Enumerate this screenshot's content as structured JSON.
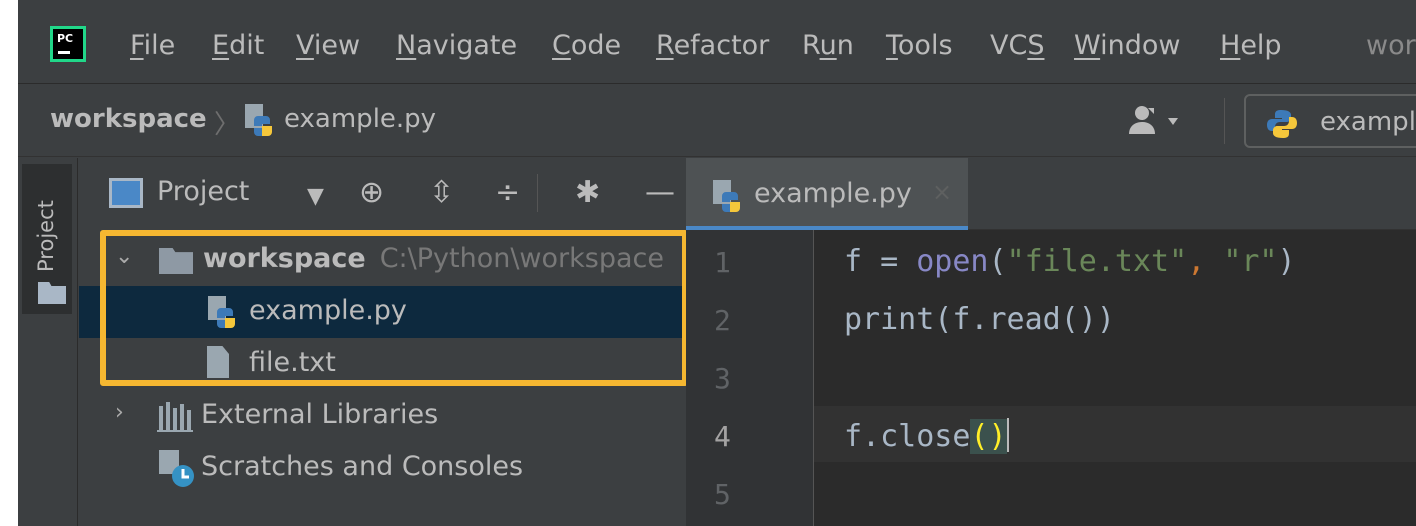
{
  "app": {
    "logo_text": "PC",
    "title_fragment": "wor"
  },
  "menu": {
    "items": [
      {
        "pre": "",
        "u": "F",
        "post": "ile"
      },
      {
        "pre": "",
        "u": "E",
        "post": "dit"
      },
      {
        "pre": "",
        "u": "V",
        "post": "iew"
      },
      {
        "pre": "",
        "u": "N",
        "post": "avigate"
      },
      {
        "pre": "",
        "u": "C",
        "post": "ode"
      },
      {
        "pre": "",
        "u": "R",
        "post": "efactor"
      },
      {
        "pre": "R",
        "u": "u",
        "post": "n"
      },
      {
        "pre": "",
        "u": "T",
        "post": "ools"
      },
      {
        "pre": "VC",
        "u": "S",
        "post": ""
      },
      {
        "pre": "",
        "u": "W",
        "post": "indow"
      },
      {
        "pre": "",
        "u": "H",
        "post": "elp"
      }
    ]
  },
  "navbar": {
    "breadcrumb_root": "workspace",
    "breadcrumb_sep": "〉",
    "breadcrumb_file": "example.py",
    "run_config_label": "exampl"
  },
  "toolstrip": {
    "project_label": "Project"
  },
  "project_panel": {
    "view_label": "Project",
    "tree": {
      "root_name": "workspace",
      "root_path": "C:\\Python\\workspace",
      "file1": "example.py",
      "file2": "file.txt",
      "external_libraries": "External Libraries",
      "scratches": "Scratches and Consoles"
    }
  },
  "editor": {
    "tab_label": "example.py",
    "tab_close": "×",
    "line_numbers": [
      "1",
      "2",
      "3",
      "4",
      "5"
    ],
    "code": {
      "line1": {
        "a": "f = ",
        "fn": "open",
        "b": "(",
        "s1": "\"file.txt\"",
        "comma": ",",
        "sp": " ",
        "s2": "\"r\"",
        "c": ")"
      },
      "line2": {
        "text": "print(f.read())"
      },
      "line4": {
        "a": "f.close",
        "b": "()"
      }
    }
  },
  "colors": {
    "highlight_box": "#f5b731",
    "selection": "#0d293e",
    "tab_underline": "#4a88c7",
    "string": "#6a8759",
    "keyword_punct": "#cc7832"
  }
}
